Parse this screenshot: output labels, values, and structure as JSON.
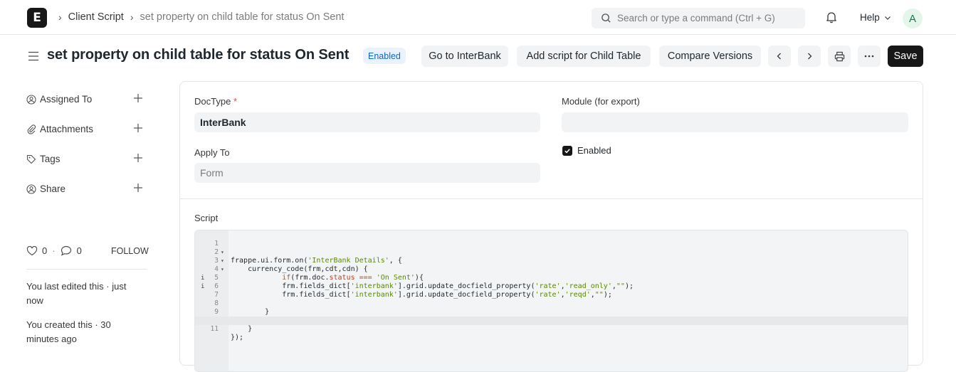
{
  "nav": {
    "logo": "E",
    "breadcrumbs": [
      "Client Script",
      "set property on child table for status On Sent"
    ],
    "search_placeholder": "Search or type a command (Ctrl + G)",
    "help_label": "Help",
    "avatar_initial": "A"
  },
  "page": {
    "title": "set property on child table for status On Sent",
    "status_badge": "Enabled",
    "buttons": {
      "go_to": "Go to InterBank",
      "add_script": "Add script for Child Table",
      "compare": "Compare Versions",
      "save": "Save"
    }
  },
  "sidebar": {
    "items": [
      {
        "label": "Assigned To",
        "icon": "assign-icon"
      },
      {
        "label": "Attachments",
        "icon": "paperclip-icon"
      },
      {
        "label": "Tags",
        "icon": "tag-icon"
      },
      {
        "label": "Share",
        "icon": "share-icon"
      }
    ],
    "likes": "0",
    "comments": "0",
    "follow": "FOLLOW",
    "last_edited": "You last edited this · just now",
    "created": "You created this · 30 minutes ago"
  },
  "form": {
    "doctype_label": "DocType",
    "doctype_required": "*",
    "doctype_value": "InterBank",
    "module_label": "Module (for export)",
    "module_value": "",
    "apply_to_label": "Apply To",
    "apply_to_placeholder": "Form",
    "enabled_label": "Enabled",
    "enabled_checked": true,
    "script_label": "Script",
    "script_lines": [
      "",
      "frappe.ui.form.on('InterBank Details', {",
      "    currency_code(frm,cdt,cdn) {",
      "            if(frm.doc.status === 'On Sent'){",
      "            frm.fields_dict['interbank'].grid.update_docfield_property('rate','read_only',\"\");",
      "            frm.fields_dict['interbank'].grid.update_docfield_property('rate','reqd',\"\");",
      "",
      "        }",
      "",
      "    }",
      "});"
    ]
  }
}
